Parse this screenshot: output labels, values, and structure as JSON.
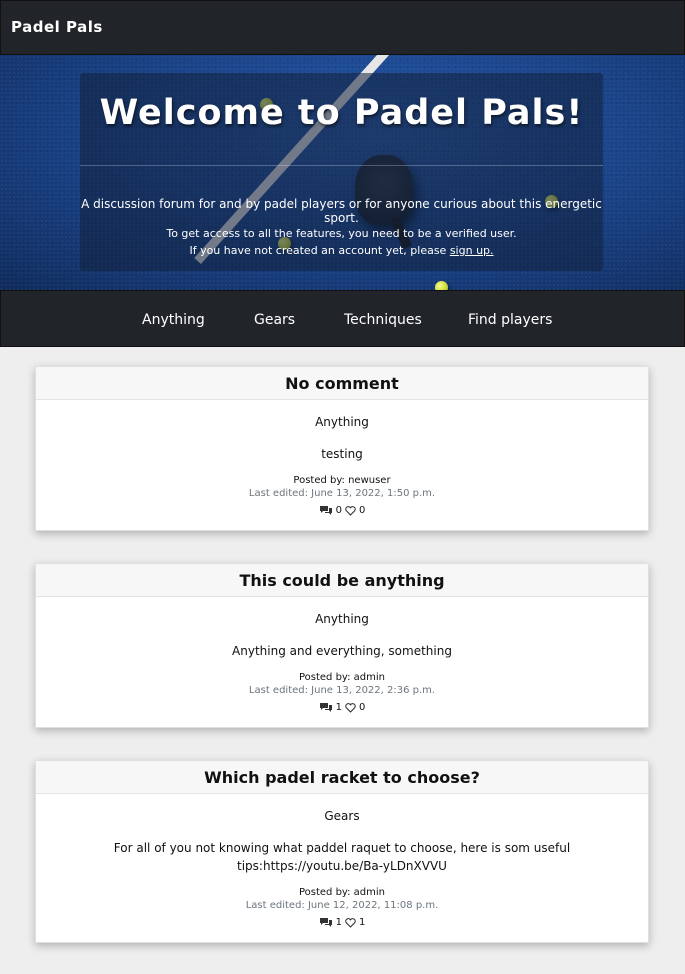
{
  "navbar": {
    "brand": "Padel Pals"
  },
  "hero": {
    "title": "Welcome to Padel Pals!",
    "description": "A discussion forum for and by padel players or for anyone curious about this energetic sport.",
    "note_line1": "To get access to all the features, you need to be a verified user.",
    "note_line2_prefix": "If you have not created an account yet, please ",
    "signup_link": "sign up."
  },
  "categories": [
    {
      "label": "Anything"
    },
    {
      "label": "Gears"
    },
    {
      "label": "Techniques"
    },
    {
      "label": "Find players"
    }
  ],
  "posts": [
    {
      "title": "No comment",
      "category": "Anything",
      "content": "testing",
      "author": "Posted by: newuser",
      "edited": "Last edited: June 13, 2022, 1:50 p.m.",
      "comments": "0",
      "likes": "0"
    },
    {
      "title": "This could be anything",
      "category": "Anything",
      "content": "Anything and everything, something",
      "author": "Posted by: admin",
      "edited": "Last edited: June 13, 2022, 2:36 p.m.",
      "comments": "1",
      "likes": "0"
    },
    {
      "title": "Which padel racket to choose?",
      "category": "Gears",
      "content": "For all of you not knowing what paddel raquet to choose, here is som useful tips:https://youtu.be/Ba-yLDnXVVU",
      "author": "Posted by: admin",
      "edited": "Last edited: June 12, 2022, 11:08 p.m.",
      "comments": "1",
      "likes": "1"
    }
  ],
  "icons": {
    "comments": "comments-icon",
    "likes": "heart-icon"
  }
}
